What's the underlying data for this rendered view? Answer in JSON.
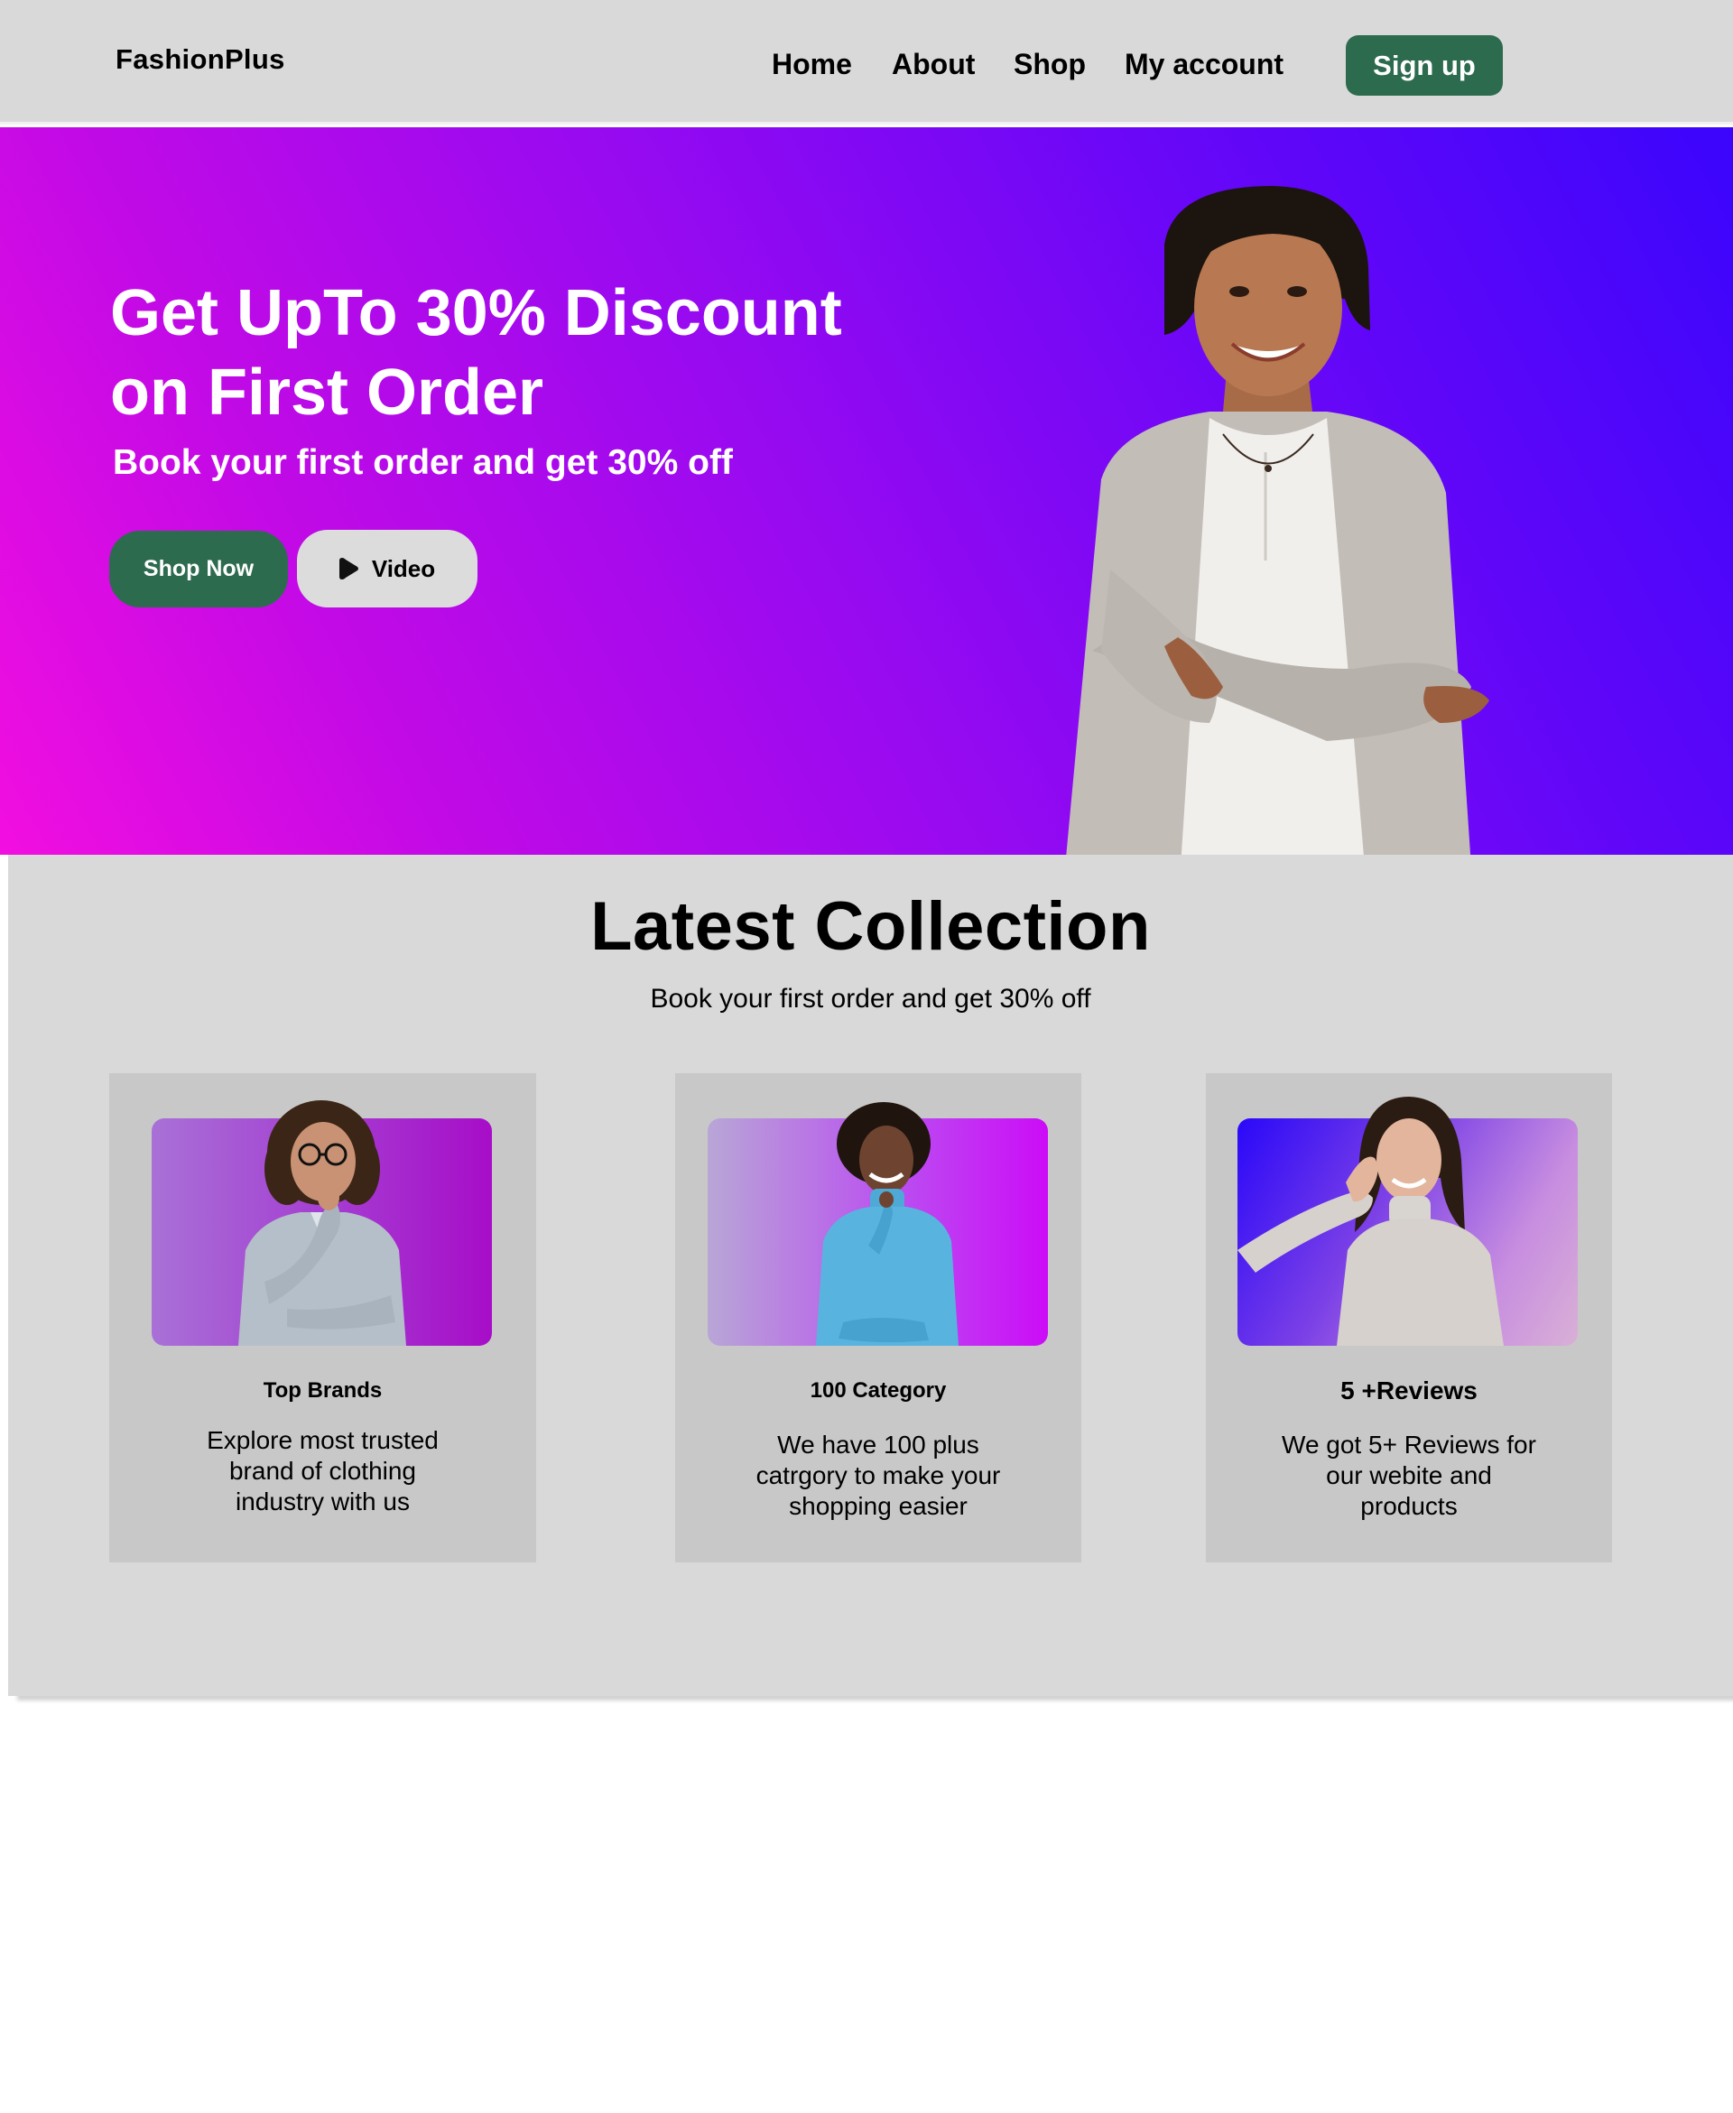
{
  "nav": {
    "logo": "FashionPlus",
    "links": [
      "Home",
      "About",
      "Shop",
      "My account"
    ],
    "signup_label": "Sign up"
  },
  "hero": {
    "title": "Get  UpTo 30% Discount\non First Order",
    "subtitle": "Book your first order and get 30% off",
    "shop_now_label": "Shop Now",
    "video_label": "Video",
    "video_icon": "play-icon"
  },
  "collection": {
    "title": "Latest Collection",
    "subtitle": "Book your first order and get 30% off",
    "cards": [
      {
        "heading": "Top Brands",
        "text": "Explore most trusted\nbrand of clothing\nindustry with us"
      },
      {
        "heading": "100  Category",
        "text": "We  have 100 plus\ncatrgory to make your\n   shopping easier"
      },
      {
        "heading": "5 +Reviews",
        "text": "We got 5+ Reviews for\nour  webite and\nproducts"
      }
    ]
  },
  "colors": {
    "nav_bg": "#d9d9d9",
    "accent_green": "#2d6b4f",
    "hero_gradient_start": "#f20ee0",
    "hero_gradient_end": "#3b05fc",
    "section_bg": "#d9d9d9",
    "card_bg": "#c8c8c8"
  }
}
